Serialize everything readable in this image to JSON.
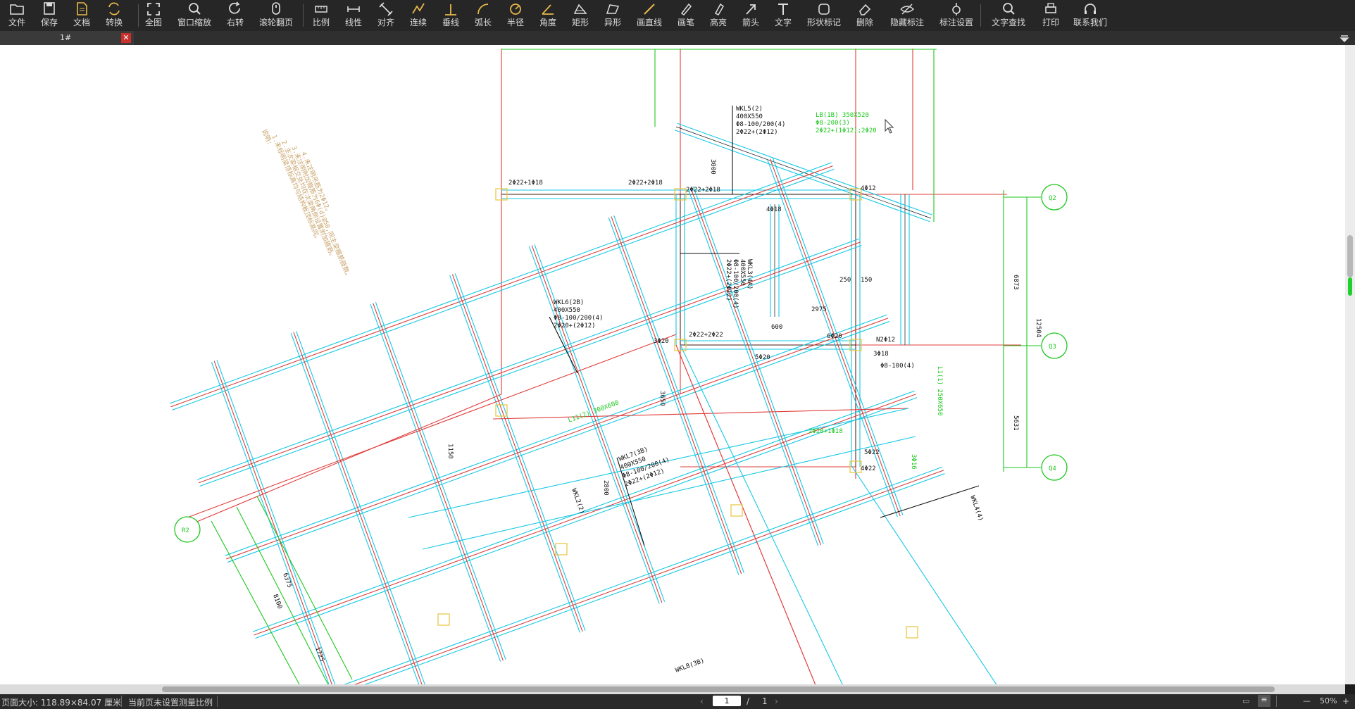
{
  "toolbar": {
    "items": [
      {
        "label": "文件",
        "icon": "folder-icon"
      },
      {
        "label": "保存",
        "icon": "save-icon"
      },
      {
        "label": "文档",
        "icon": "document-icon"
      },
      {
        "label": "转换",
        "icon": "convert-icon"
      },
      {
        "label": "全图",
        "icon": "fullview-icon"
      },
      {
        "label": "窗口缩放",
        "icon": "zoom-icon"
      },
      {
        "label": "右转",
        "icon": "rotate-right-icon"
      },
      {
        "label": "滚轮翻页",
        "icon": "mouse-wheel-icon"
      },
      {
        "label": "比例",
        "icon": "scale-icon"
      },
      {
        "label": "线性",
        "icon": "linear-dim-icon"
      },
      {
        "label": "对齐",
        "icon": "aligned-dim-icon"
      },
      {
        "label": "连续",
        "icon": "continuous-dim-icon"
      },
      {
        "label": "垂线",
        "icon": "perpendicular-icon"
      },
      {
        "label": "弧长",
        "icon": "arc-length-icon"
      },
      {
        "label": "半径",
        "icon": "radius-icon"
      },
      {
        "label": "角度",
        "icon": "angle-icon"
      },
      {
        "label": "矩形",
        "icon": "rectangle-area-icon"
      },
      {
        "label": "异形",
        "icon": "polygon-area-icon"
      },
      {
        "label": "画直线",
        "icon": "line-icon"
      },
      {
        "label": "画笔",
        "icon": "pen-icon"
      },
      {
        "label": "高亮",
        "icon": "highlight-icon"
      },
      {
        "label": "箭头",
        "icon": "arrow-icon"
      },
      {
        "label": "文字",
        "icon": "text-icon"
      },
      {
        "label": "形状标记",
        "icon": "shape-mark-icon"
      },
      {
        "label": "删除",
        "icon": "eraser-icon"
      },
      {
        "label": "隐藏标注",
        "icon": "eye-hide-icon"
      },
      {
        "label": "标注设置",
        "icon": "annotation-settings-icon"
      },
      {
        "label": "文字查找",
        "icon": "search-icon"
      },
      {
        "label": "打印",
        "icon": "print-icon"
      },
      {
        "label": "联系我们",
        "icon": "headset-icon"
      }
    ]
  },
  "tab": {
    "title": "1#",
    "close": "✕"
  },
  "drawing": {
    "axes": [
      "Q2",
      "Q3",
      "Q4",
      "R2"
    ],
    "dims": [
      "6873",
      "12504",
      "5631",
      "6375",
      "8100",
      "1725",
      "3000",
      "3650",
      "2975",
      "600",
      "250",
      "150",
      "1150",
      "2800"
    ],
    "labels": [
      "WKL5(2)",
      "400X550",
      "Φ8-100/200(4)",
      "2Φ22+(2Φ12)",
      "LB(1B) 350X520",
      "Φ8-200(3)",
      "2Φ22+(1Φ12);2Φ20",
      "WKL6(2B)",
      "400X550",
      "Φ8-100/200(4)",
      "2Φ20+(2Φ12)",
      "WKL3(4A)",
      "400X550",
      "Φ8-100/200(4)",
      "2Φ22+(2Φ12)",
      "WKL7(3B)",
      "400X550",
      "Φ8-100/200(4)",
      "2Φ22+(2Φ12)",
      "WKL2(2)",
      "WKL8(3B)",
      "WKL4(4)",
      "L11(2) 300X600",
      "2Φ22+1Φ18",
      "2Φ22+2Φ18",
      "2Φ22+2Φ18",
      "4Φ12",
      "4Φ18",
      "3Φ20",
      "N2Φ12",
      "2Φ22+2Φ22",
      "5Φ20",
      "6Φ20",
      "3Φ18",
      "Φ8-100(4)",
      "4Φ22",
      "5Φ22",
      "3Φ16",
      "2Φ20+1Φ18",
      "L1(1) 250X650"
    ],
    "notes": [
      "说明:",
      "1.未标明梁顶标高均与结构板顶标高同。",
      "2.主次梁相交处均在次梁两侧设置附加箍筋。",
      "3.未注明附加箍筋为6Φ(d)@50,同主梁箍筋肢数。",
      "4.未注明吊筋为2Φ12。"
    ]
  },
  "status": {
    "page_size": "页面大小: 118.89×84.07 厘米",
    "scale_note": "当前页未设置测量比例",
    "page_current": "1",
    "page_sep": "/",
    "page_total": "1",
    "zoom": "50%",
    "zoom_minus": "—",
    "zoom_plus": "+"
  }
}
